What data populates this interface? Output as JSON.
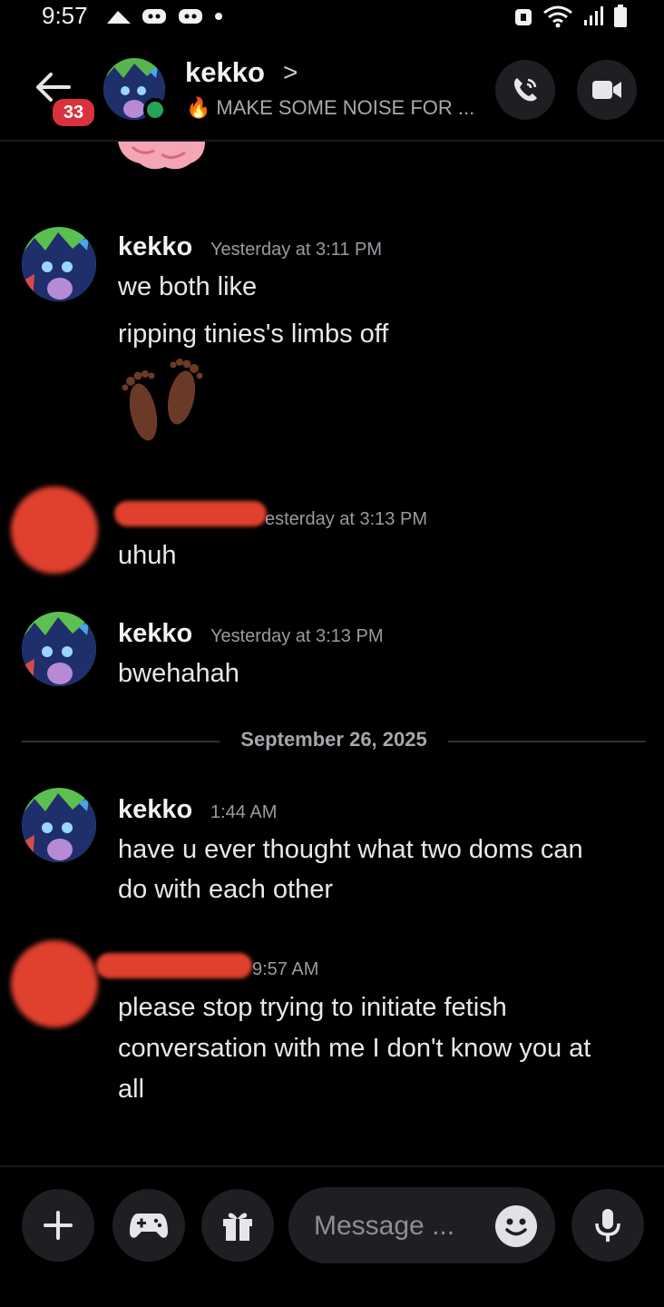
{
  "status_bar": {
    "time": "9:57"
  },
  "header": {
    "unread_count": "33",
    "name": "kekko",
    "chevron": ">",
    "status_emoji": "🔥",
    "status_text": "MAKE SOME NOISE FOR ..."
  },
  "messages": [
    {
      "author": "kekko",
      "time": "Yesterday at 3:11 PM",
      "lines": [
        "we both like",
        "ripping tinies's limbs off"
      ],
      "emoji_icon": "footprints-icon"
    },
    {
      "author_redacted": true,
      "time_visible": "esterday at 3:13 PM",
      "lines": [
        "uhuh"
      ]
    },
    {
      "author": "kekko",
      "time": "Yesterday at 3:13 PM",
      "lines": [
        "bwehahah"
      ]
    },
    {
      "author": "kekko",
      "time": "1:44 AM",
      "lines": [
        "have u ever thought what two doms can",
        "do with each other"
      ]
    },
    {
      "author_redacted": true,
      "time_visible": "9:57 AM",
      "lines": [
        "please stop trying to initiate fetish",
        "conversation with me I don't know you at",
        "all"
      ]
    }
  ],
  "date_divider": "September 26, 2025",
  "composer": {
    "placeholder": "Message ..."
  },
  "colors": {
    "background": "#000000",
    "redaction": "#e0402e",
    "online": "#23a55a",
    "badge": "#d9323e"
  }
}
